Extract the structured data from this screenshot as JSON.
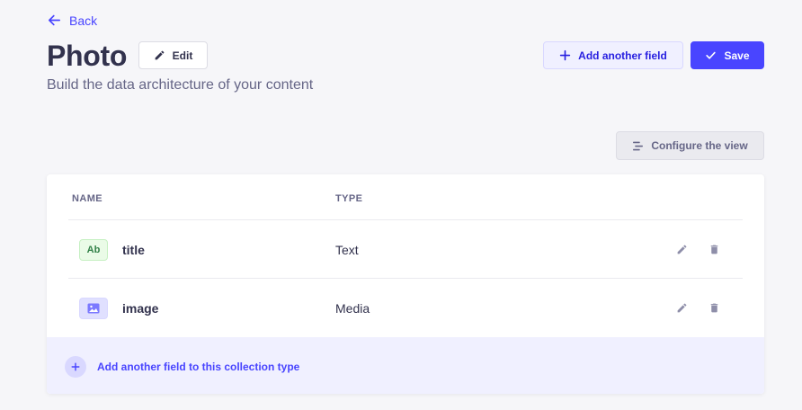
{
  "header": {
    "back_label": "Back",
    "title": "Photo",
    "edit_label": "Edit",
    "subtitle": "Build the data architecture of your content",
    "add_field_label": "Add another field",
    "save_label": "Save"
  },
  "toolbar": {
    "configure_label": "Configure the view"
  },
  "table": {
    "columns": [
      "NAME",
      "TYPE"
    ],
    "rows": [
      {
        "icon": "text-type-icon",
        "icon_label": "Ab",
        "name": "title",
        "type": "Text"
      },
      {
        "icon": "media-type-icon",
        "name": "image",
        "type": "Media"
      }
    ],
    "footer_label": "Add another field to this collection type"
  },
  "colors": {
    "primary": "#4945ff",
    "background": "#f6f6f9",
    "text": "#32324d",
    "muted": "#666687"
  }
}
